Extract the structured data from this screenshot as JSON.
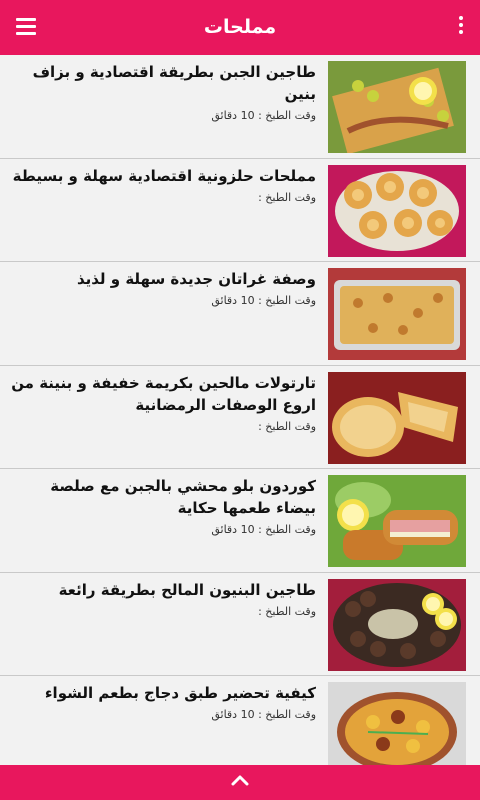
{
  "header": {
    "title": "مملحات",
    "menu_icon": "menu-icon",
    "more_icon": "more-vert-icon"
  },
  "recipes": [
    {
      "title": "طاجين الجبن بطريقة اقتصادية و بزاف بنين",
      "cook_label": "وقت الطبخ :",
      "cook_time": "10 دقائق"
    },
    {
      "title": "مملحات حلزونية اقتصادية سهلة و بسيطة",
      "cook_label": "وقت الطبخ :",
      "cook_time": ""
    },
    {
      "title": "وصفة غراتان جديدة سهلة و لذيذ",
      "cook_label": "وقت الطبخ :",
      "cook_time": "10 دقائق"
    },
    {
      "title": "تارتولات مالحين بكريمة خفيفة و بنينة من اروع الوصفات الرمضانية",
      "cook_label": "وقت الطبخ :",
      "cook_time": ""
    },
    {
      "title": "كوردون بلو محشي بالجبن مع صلصة بيضاء طعمها حكاية",
      "cook_label": "وقت الطبخ :",
      "cook_time": "10 دقائق"
    },
    {
      "title": "طاجين البنيون المالح بطريقة رائعة",
      "cook_label": "وقت الطبخ :",
      "cook_time": ""
    },
    {
      "title": "كيفية تحضير طبق دجاج بطعم الشواء",
      "cook_label": "وقت الطبخ :",
      "cook_time": "10 دقائق"
    }
  ],
  "footer": {
    "icon": "chevron-up-icon"
  },
  "colors": {
    "accent": "#e8175d",
    "background": "#f2f2f2"
  }
}
